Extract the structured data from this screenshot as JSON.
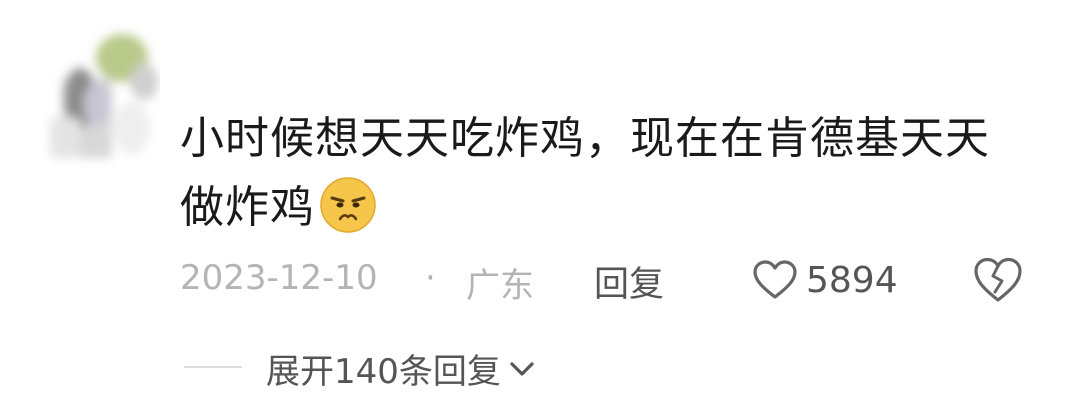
{
  "comment": {
    "text_line1": "小时候想天天吃炸鸡，现在在肯德基天天",
    "text_line2": "做炸鸡",
    "emoji": "frowning-face"
  },
  "meta": {
    "date": "2023-12-10",
    "separator": "·",
    "location": "广东",
    "reply_label": "回复",
    "like_count": "5894"
  },
  "replies": {
    "expand_label": "展开140条回复"
  }
}
